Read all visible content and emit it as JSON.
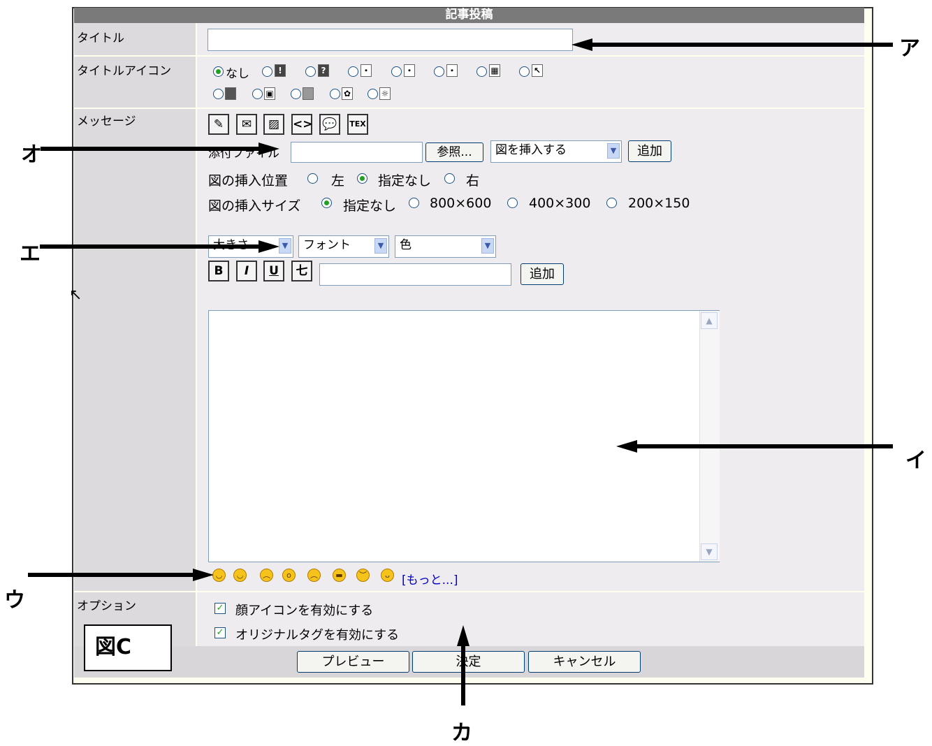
{
  "form": {
    "header_title": "記事投稿",
    "labels": {
      "title": "タイトル",
      "title_icon": "タイトルアイコン",
      "message": "メッセージ",
      "options": "オプション"
    },
    "title_input_value": "",
    "title_icon": {
      "none_label": "なし",
      "selected": "なし"
    },
    "attachment": {
      "label": "添付ファイル",
      "browse_label": "参照...",
      "insert_select_value": "図を挿入する",
      "add_label": "追加"
    },
    "insert_position": {
      "label": "図の挿入位置",
      "options": [
        "左",
        "指定なし",
        "右"
      ],
      "selected": "指定なし"
    },
    "insert_size": {
      "label": "図の挿入サイズ",
      "options": [
        "指定なし",
        "800×600",
        "400×300",
        "200×150"
      ],
      "selected": "指定なし"
    },
    "formatting": {
      "size_select": "大きさ",
      "font_select": "フォント",
      "color_select": "色",
      "bold": "B",
      "italic": "I",
      "underline": "U",
      "strike": "七",
      "add_label": "追加"
    },
    "toolbar_icons": [
      "pen-icon",
      "mail-icon",
      "image-icon",
      "code-icon",
      "speech-bubble-icon",
      "tex-icon"
    ],
    "tex_label": "TEX",
    "message_value": "",
    "emoticons_more": "[もっと...]",
    "options": {
      "face_icon": "顔アイコンを有効にする",
      "original_tag": "オリジナルタグを有効にする"
    },
    "buttons": {
      "preview": "プレビュー",
      "submit": "決定",
      "cancel": "キャンセル"
    }
  },
  "figure_label": "図C",
  "callouts": {
    "a": "ア",
    "i": "イ",
    "u": "ウ",
    "e": "エ",
    "o": "オ",
    "ka": "カ"
  }
}
